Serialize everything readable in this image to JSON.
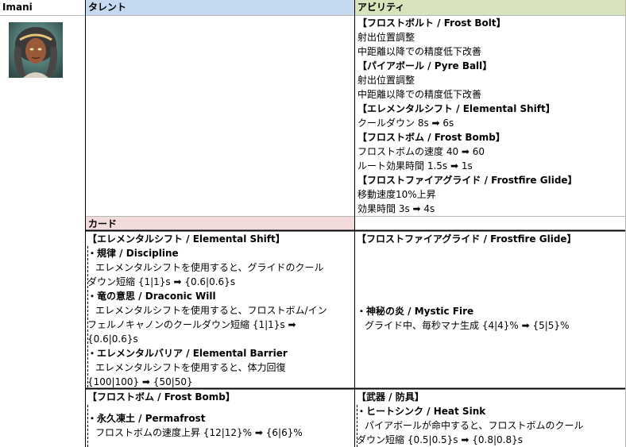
{
  "header": {
    "name": "Imani",
    "talent": "タレント",
    "ability": "アビリティ"
  },
  "colors": {
    "talent_header_bg": "#c5d9f1",
    "ability_header_bg": "#d8e4bc",
    "card_header_bg": "#f2dcdb",
    "grid": "#b7b7b7"
  },
  "portrait_icon": "imani-portrait",
  "ability_lines": [
    {
      "text": "【フロストボルト / Frost Bolt】",
      "bold": true
    },
    {
      "text": "射出位置調整",
      "bold": false
    },
    {
      "text": "中距離以降での精度低下改善",
      "bold": false
    },
    {
      "text": "【パイアボール / Pyre Ball】",
      "bold": true
    },
    {
      "text": "射出位置調整",
      "bold": false
    },
    {
      "text": "中距離以降での精度低下改善",
      "bold": false
    },
    {
      "text": "【エレメンタルシフト / Elemental Shift】",
      "bold": true
    },
    {
      "text": "クールダウン 8s ➡ 6s",
      "bold": false
    },
    {
      "text": "【フロストボム / Frost Bomb】",
      "bold": true
    },
    {
      "text": "フロストボムの速度 40 ➡ 60",
      "bold": false
    },
    {
      "text": "ルート効果時間 1.5s ➡ 1s",
      "bold": false
    },
    {
      "text": "【フロストファイアグライド / Frostfire Glide】",
      "bold": true
    },
    {
      "text": "移動速度10%上昇",
      "bold": false
    },
    {
      "text": "効果時間 3s ➡ 4s",
      "bold": false
    }
  ],
  "card_label": "カード",
  "cards": {
    "elemental_shift": {
      "title": "【エレメンタルシフト / Elemental Shift】",
      "items": [
        {
          "name": "・規律 / Discipline",
          "desc": [
            "エレメンタルシフトを使用すると、グライドのクール",
            "ダウン短縮 {1|1}s ➡ {0.6|0.6}s"
          ]
        },
        {
          "name": "・竜の意思 / Draconic Will",
          "desc": [
            "エレメンタルシフトを使用すると、フロストボム/イン",
            "フェルノキャノンのクールダウン短縮 {1|1}s ➡",
            "{0.6|0.6}s"
          ]
        },
        {
          "name": "・エレメンタルバリア / Elemental Barrier",
          "desc": [
            "エレメンタルシフトを使用すると、体力回復",
            "{100|100} ➡ {50|50}"
          ]
        }
      ]
    },
    "frostfire_glide": {
      "title": "【フロストファイアグライド / Frostfire Glide】",
      "items": [
        {
          "name": "・神秘の炎 / Mystic Fire",
          "desc": [
            "グライド中、毎秒マナ生成 {4|4}% ➡ {5|5}%"
          ]
        }
      ]
    },
    "frost_bomb": {
      "title": "【フロストボム / Frost Bomb】",
      "items": [
        {
          "name": "・永久凍土 / Permafrost",
          "desc": [
            "フロストボムの速度上昇 {12|12}% ➡ {6|6}%"
          ]
        }
      ]
    },
    "weapon_armor": {
      "title": "【武器 / 防具】",
      "items": [
        {
          "name": "・ヒートシンク / Heat Sink",
          "desc": [
            "パイアボールが命中すると、フロストボムのクール",
            "ダウン短縮 {0.5|0.5}s ➡ {0.8|0.8}s"
          ]
        }
      ]
    }
  }
}
